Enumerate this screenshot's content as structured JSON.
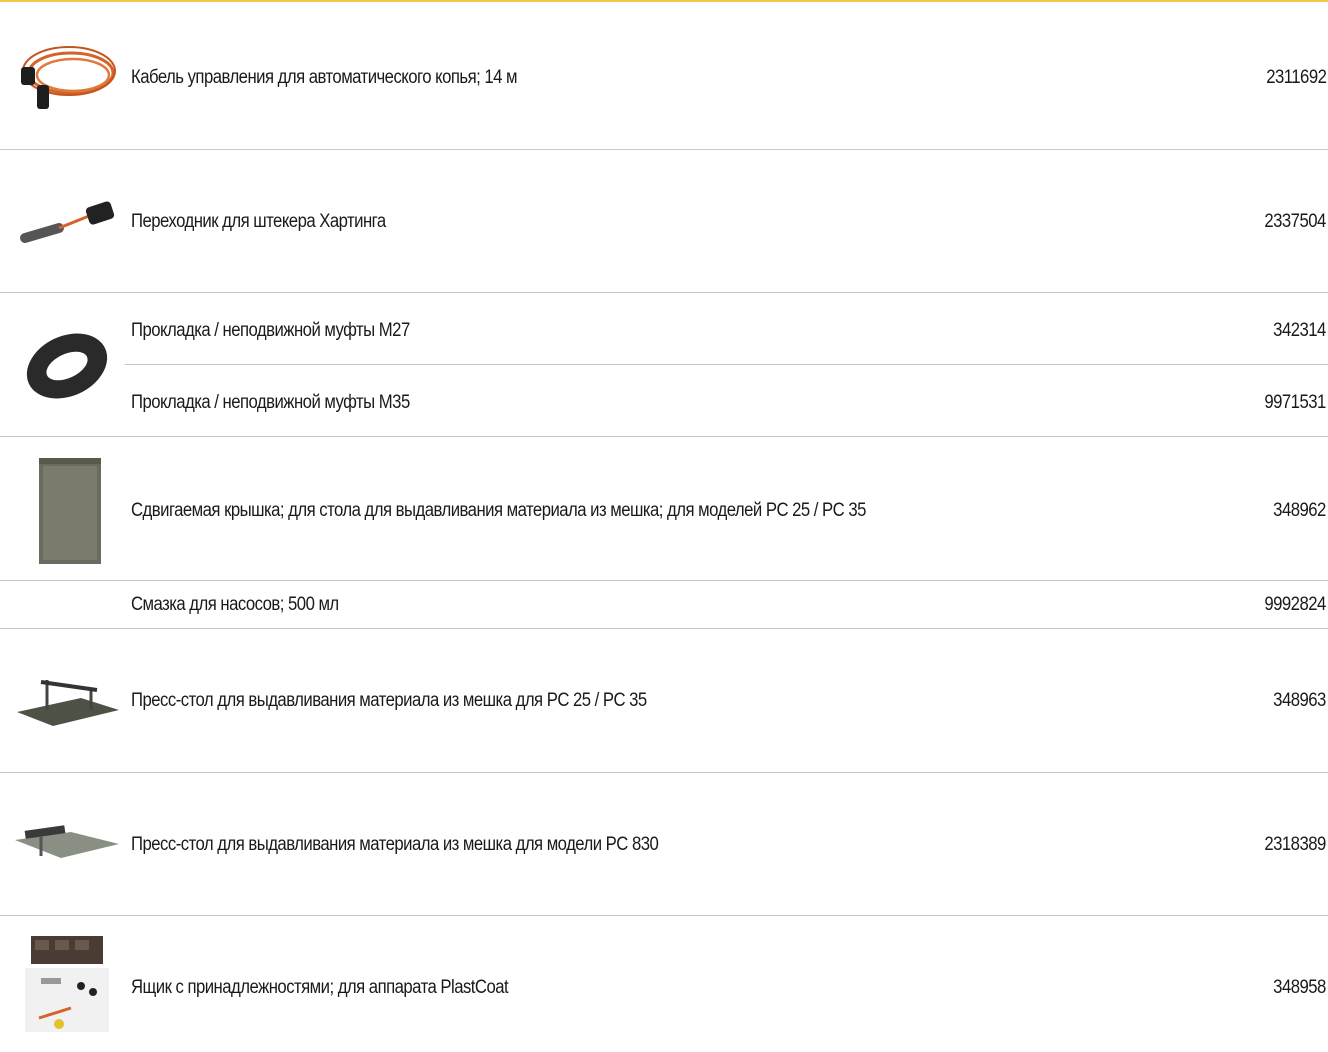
{
  "items": [
    {
      "label": "Кабель управления для автоматического копья; 14 м",
      "code": "2311692",
      "icon": "cable-coil-icon"
    },
    {
      "label": "Переходник для штекера Хартинга",
      "code": "2337504",
      "icon": "plug-adapter-icon"
    },
    {
      "label": "Прокладка / неподвижной муфты M27",
      "code": "342314",
      "icon": "gasket-ring-icon"
    },
    {
      "label": "Прокладка / неподвижной муфты M35",
      "code": "9971531"
    },
    {
      "label": "Сдвигаемая крышка; для стола для выдавливания материала из мешка; для моделей PC 25 / PC 35",
      "code": "348962",
      "icon": "sliding-cover-icon"
    },
    {
      "label": "Смазка для насосов; 500 мл",
      "code": "9992824"
    },
    {
      "label": "Пресс-стол для выдавливания материала из мешка для PC 25 / PC 35",
      "code": "348963",
      "icon": "press-table-icon"
    },
    {
      "label": "Пресс-стол для выдавливания материала из мешка для модели PC 830",
      "code": "2318389",
      "icon": "press-table-icon"
    },
    {
      "label": "Ящик с принадлежностями; для аппарата PlastCoat",
      "code": "348958",
      "icon": "accessory-box-icon"
    }
  ],
  "colors": {
    "accent": "#f2c94c",
    "separator": "#c8c8c8"
  }
}
